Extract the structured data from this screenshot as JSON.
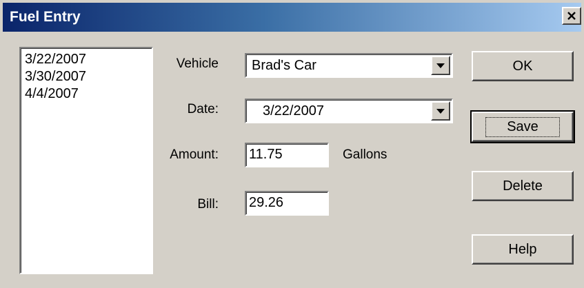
{
  "window": {
    "title": "Fuel Entry",
    "close_label": "×"
  },
  "list": {
    "items": [
      "3/22/2007",
      "3/30/2007",
      "4/4/2007"
    ]
  },
  "form": {
    "vehicle_label": "Vehicle",
    "vehicle_value": "Brad's Car",
    "date_label": "Date:",
    "date_value": "3/22/2007",
    "amount_label": "Amount:",
    "amount_value": "11.75",
    "amount_unit": "Gallons",
    "bill_label": "Bill:",
    "bill_value": "29.26"
  },
  "buttons": {
    "ok": "OK",
    "save": "Save",
    "delete": "Delete",
    "help": "Help"
  },
  "icons": {
    "close": "close-icon",
    "dropdown": "chevron-down-icon"
  }
}
